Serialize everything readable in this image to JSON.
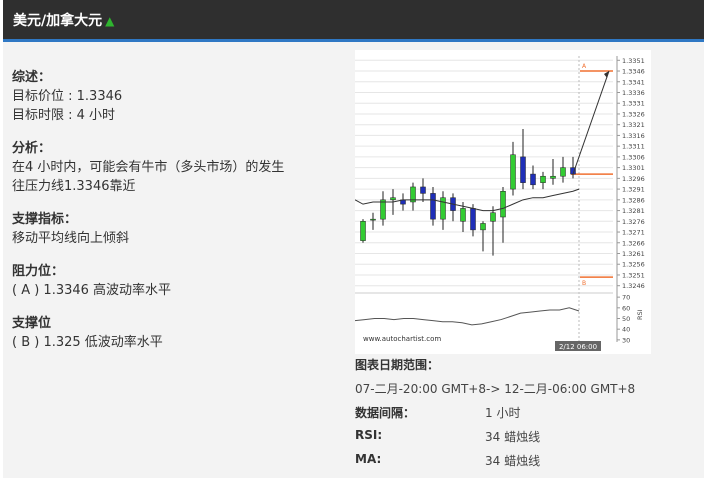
{
  "header": {
    "title": "美元/加拿大元",
    "trend_icon": "up-triangle-icon"
  },
  "summary": {
    "overview_heading": "综述：",
    "target_price": "目标价位 : 1.3346",
    "target_time": "目标时限 : 4 小时",
    "analysis_heading": "分析：",
    "analysis_line1": "在4 小时内，可能会有牛市（多头市场）的发生",
    "analysis_line2": "往压力线1.3346靠近",
    "support_indicator_heading": "支撑指标：",
    "support_indicator_text": "移动平均线向上倾斜",
    "resistance_heading": "阻力位：",
    "resistance_text": "( A ) 1.3346  高波动率水平",
    "support_heading": "支撑位",
    "support_text": "( B ) 1.325  低波动率水平"
  },
  "chart_info": {
    "date_range_label": "图表日期范围：",
    "date_range_value": "07-二月-20:00 GMT+8-> 12-二月-06:00 GMT+8",
    "interval_label": "数据间隔：",
    "interval_value": "1 小时",
    "rsi_label": "RSI:",
    "rsi_value": "34 蜡烛线",
    "ma_label": "MA:",
    "ma_value": "34 蜡烛线"
  },
  "chart_data": {
    "type": "candlestick",
    "watermark": "www.autochartist.com",
    "time_label": "2/12 06:00",
    "rsi_axis_label": "RSI",
    "y_ticks": [
      "1.3351",
      "1.3346",
      "1.3341",
      "1.3336",
      "1.3331",
      "1.3326",
      "1.3321",
      "1.3316",
      "1.3311",
      "1.3306",
      "1.3301",
      "1.3296",
      "1.3291",
      "1.3286",
      "1.3281",
      "1.3276",
      "1.3271",
      "1.3266",
      "1.3261",
      "1.3256",
      "1.3251",
      "1.3246"
    ],
    "y_range": [
      1.3244,
      1.3353
    ],
    "rsi_ticks": [
      "70",
      "60",
      "50",
      "40",
      "30"
    ],
    "rsi_range": [
      28,
      72
    ],
    "resistance": {
      "label": "A",
      "value": 1.3346
    },
    "support": {
      "label": "B",
      "value": 1.325
    },
    "projection_target": 1.3346,
    "colors": {
      "up": "#33cc33",
      "down": "#1f2fb8",
      "level": "#f07030",
      "projection": "#333333",
      "ma": "#333333",
      "rsi": "#555555"
    },
    "candles": [
      {
        "o": 1.3267,
        "h": 1.3277,
        "l": 1.3266,
        "c": 1.3276
      },
      {
        "o": 1.3277,
        "h": 1.328,
        "l": 1.3272,
        "c": 1.3277
      },
      {
        "o": 1.3277,
        "h": 1.329,
        "l": 1.3274,
        "c": 1.3286
      },
      {
        "o": 1.3286,
        "h": 1.3291,
        "l": 1.3279,
        "c": 1.3287
      },
      {
        "o": 1.3286,
        "h": 1.3289,
        "l": 1.3281,
        "c": 1.3284
      },
      {
        "o": 1.3285,
        "h": 1.3294,
        "l": 1.3281,
        "c": 1.3292
      },
      {
        "o": 1.3292,
        "h": 1.3296,
        "l": 1.3285,
        "c": 1.3289
      },
      {
        "o": 1.3289,
        "h": 1.3292,
        "l": 1.3274,
        "c": 1.3277
      },
      {
        "o": 1.3277,
        "h": 1.329,
        "l": 1.3272,
        "c": 1.3287
      },
      {
        "o": 1.3287,
        "h": 1.3289,
        "l": 1.3276,
        "c": 1.3281
      },
      {
        "o": 1.3276,
        "h": 1.3285,
        "l": 1.3271,
        "c": 1.3282
      },
      {
        "o": 1.3282,
        "h": 1.3284,
        "l": 1.3269,
        "c": 1.3272
      },
      {
        "o": 1.3272,
        "h": 1.3276,
        "l": 1.3262,
        "c": 1.3275
      },
      {
        "o": 1.3276,
        "h": 1.3283,
        "l": 1.326,
        "c": 1.328
      },
      {
        "o": 1.3278,
        "h": 1.3292,
        "l": 1.3266,
        "c": 1.329
      },
      {
        "o": 1.3291,
        "h": 1.3313,
        "l": 1.3288,
        "c": 1.3307
      },
      {
        "o": 1.3306,
        "h": 1.3319,
        "l": 1.3291,
        "c": 1.3294
      },
      {
        "o": 1.3298,
        "h": 1.3302,
        "l": 1.3291,
        "c": 1.3293
      },
      {
        "o": 1.3294,
        "h": 1.3299,
        "l": 1.3291,
        "c": 1.3297
      },
      {
        "o": 1.3296,
        "h": 1.3305,
        "l": 1.3293,
        "c": 1.3297
      },
      {
        "o": 1.3297,
        "h": 1.3306,
        "l": 1.3294,
        "c": 1.3301
      },
      {
        "o": 1.3301,
        "h": 1.3306,
        "l": 1.3296,
        "c": 1.3298
      }
    ],
    "ma": [
      1.3284,
      1.3285,
      1.3285,
      1.3285,
      1.3286,
      1.3286,
      1.3286,
      1.3286,
      1.3285,
      1.3284,
      1.3283,
      1.3282,
      1.3281,
      1.3281,
      1.3282,
      1.3284,
      1.3286,
      1.3287,
      1.3287,
      1.3288,
      1.3289,
      1.329
    ],
    "rsi": [
      48,
      49,
      50,
      50,
      49,
      50,
      50,
      49,
      48,
      47,
      47,
      46,
      44,
      45,
      47,
      49,
      52,
      55,
      56,
      57,
      58,
      58,
      60,
      57
    ]
  }
}
